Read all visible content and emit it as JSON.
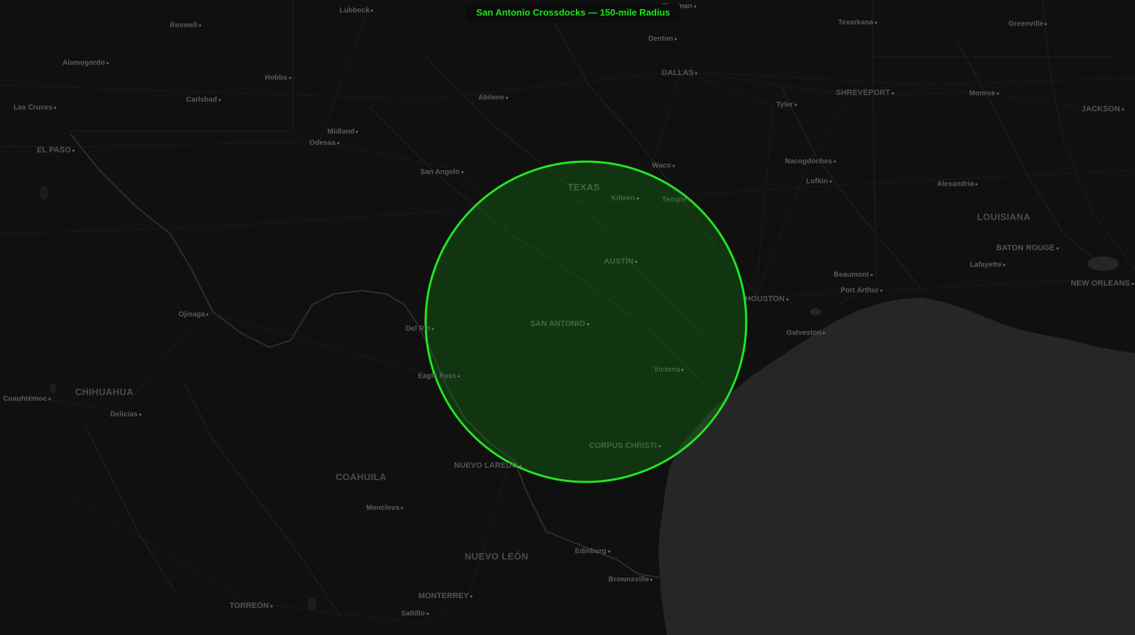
{
  "map": {
    "title": "San Antonio Crossdocks — 150-mile Radius",
    "radius": {
      "center": "SAN ANTONIO",
      "miles": 150,
      "color": "#22e622"
    },
    "colors": {
      "land": "#101010",
      "water": "#262626",
      "circle_stroke": "#22e622"
    },
    "labels": [
      {
        "id": "lubbock",
        "text": "Lubbock",
        "cls": "city"
      },
      {
        "id": "sherman",
        "text": "Sherman",
        "cls": "city"
      },
      {
        "id": "roswell",
        "text": "Roswell",
        "cls": "city"
      },
      {
        "id": "texarkana",
        "text": "Texarkana",
        "cls": "city"
      },
      {
        "id": "greenville",
        "text": "Greenville",
        "cls": "city"
      },
      {
        "id": "denton",
        "text": "Denton",
        "cls": "city"
      },
      {
        "id": "alamogordo",
        "text": "Alamogordo",
        "cls": "city"
      },
      {
        "id": "dallas",
        "text": "DALLAS",
        "cls": "large"
      },
      {
        "id": "hobbs",
        "text": "Hobbs",
        "cls": "city"
      },
      {
        "id": "carlsbad",
        "text": "Carlsbad",
        "cls": "city"
      },
      {
        "id": "abilene",
        "text": "Abilene",
        "cls": "city"
      },
      {
        "id": "shreveport",
        "text": "SHREVEPORT",
        "cls": "large"
      },
      {
        "id": "monroe",
        "text": "Monroe",
        "cls": "city"
      },
      {
        "id": "jackson",
        "text": "JACKSON",
        "cls": "large"
      },
      {
        "id": "lascruces",
        "text": "Las Cruces",
        "cls": "city"
      },
      {
        "id": "tyler",
        "text": "Tyler",
        "cls": "city"
      },
      {
        "id": "midland",
        "text": "Midland",
        "cls": "city"
      },
      {
        "id": "odessa",
        "text": "Odessa",
        "cls": "city"
      },
      {
        "id": "elpaso",
        "text": "EL PASO",
        "cls": "large"
      },
      {
        "id": "nacogdoches",
        "text": "Nacogdoches",
        "cls": "city"
      },
      {
        "id": "waco",
        "text": "Waco",
        "cls": "city"
      },
      {
        "id": "sanangelo",
        "text": "San Angelo",
        "cls": "city"
      },
      {
        "id": "lufkin",
        "text": "Lufkin",
        "cls": "city"
      },
      {
        "id": "alexandria",
        "text": "Alexandria",
        "cls": "city"
      },
      {
        "id": "texas",
        "text": "TEXAS",
        "cls": "region inside"
      },
      {
        "id": "killeen",
        "text": "Killeen",
        "cls": "city inside"
      },
      {
        "id": "temple",
        "text": "Temple",
        "cls": "city inside"
      },
      {
        "id": "louisiana",
        "text": "LOUISIANA",
        "cls": "region"
      },
      {
        "id": "batonrouge",
        "text": "BATON ROUGE",
        "cls": "large"
      },
      {
        "id": "austin",
        "text": "AUSTIN",
        "cls": "large inside"
      },
      {
        "id": "lafayette",
        "text": "Lafayette",
        "cls": "city"
      },
      {
        "id": "beaumont",
        "text": "Beaumont",
        "cls": "city"
      },
      {
        "id": "neworleans",
        "text": "NEW ORLEANS",
        "cls": "large"
      },
      {
        "id": "portarthur",
        "text": "Port Arthur",
        "cls": "city"
      },
      {
        "id": "houston",
        "text": "HOUSTON",
        "cls": "large"
      },
      {
        "id": "ojinaga",
        "text": "Ojinaga",
        "cls": "city"
      },
      {
        "id": "sanantonio",
        "text": "SAN ANTONIO",
        "cls": "large inside"
      },
      {
        "id": "delrio",
        "text": "Del Rio",
        "cls": "city"
      },
      {
        "id": "galveston",
        "text": "Galveston",
        "cls": "city"
      },
      {
        "id": "victoria",
        "text": "Victoria",
        "cls": "city inside"
      },
      {
        "id": "eaglepass",
        "text": "Eagle Pass",
        "cls": "city"
      },
      {
        "id": "chihuahua",
        "text": "CHIHUAHUA",
        "cls": "region"
      },
      {
        "id": "cuauhtemoc",
        "text": "Cuauhtémoc",
        "cls": "city"
      },
      {
        "id": "delicias",
        "text": "Delicias",
        "cls": "city"
      },
      {
        "id": "corpuschristi",
        "text": "CORPUS CHRISTI",
        "cls": "large inside"
      },
      {
        "id": "nuevolaredo",
        "text": "NUEVO LAREDO",
        "cls": "large"
      },
      {
        "id": "coahuila",
        "text": "COAHUILA",
        "cls": "region"
      },
      {
        "id": "monclova",
        "text": "Monclova",
        "cls": "city"
      },
      {
        "id": "edinburg",
        "text": "Edinburg",
        "cls": "city"
      },
      {
        "id": "nuevoleon",
        "text": "NUEVO LEÓN",
        "cls": "region"
      },
      {
        "id": "brownsville",
        "text": "Brownsville",
        "cls": "city"
      },
      {
        "id": "monterrey",
        "text": "MONTERREY",
        "cls": "large"
      },
      {
        "id": "torreon",
        "text": "TORREÓN",
        "cls": "large"
      },
      {
        "id": "saltillo",
        "text": "Saltillo",
        "cls": "city"
      }
    ]
  }
}
